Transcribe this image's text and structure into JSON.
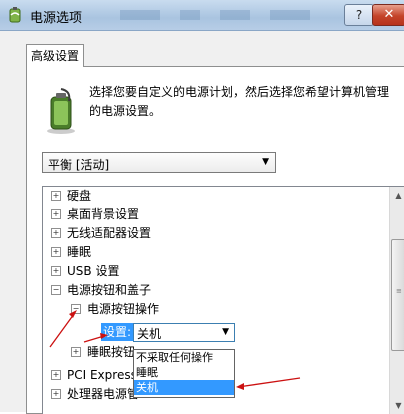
{
  "window": {
    "title": "电源选项",
    "help_label": "?",
    "close_label": "✕"
  },
  "tab": {
    "label": "高级设置"
  },
  "description": "选择您要自定义的电源计划，然后选择您希望计算机管理的电源设置。",
  "plan": {
    "selected": "平衡 [活动]"
  },
  "tree": [
    {
      "expander": "+",
      "label": "硬盘"
    },
    {
      "expander": "+",
      "label": "桌面背景设置"
    },
    {
      "expander": "+",
      "label": "无线适配器设置"
    },
    {
      "expander": "+",
      "label": "睡眠"
    },
    {
      "expander": "+",
      "label": "USB 设置"
    },
    {
      "expander": "−",
      "label": "电源按钮和盖子"
    },
    {
      "expander": "−",
      "label": "电源按钮操作"
    },
    {
      "expander": "+",
      "label": "睡眠按钮"
    },
    {
      "expander": "+",
      "label": "PCI Express"
    },
    {
      "expander": "+",
      "label": "处理器电源管"
    }
  ],
  "setting": {
    "label": "设置:",
    "value": "关机"
  },
  "dropdown": {
    "options": [
      "不采取任何操作",
      "睡眠",
      "关机"
    ],
    "selected_index": 2
  },
  "colors": {
    "selection": "#3399ff",
    "arrow_annotation": "#cc1111"
  }
}
